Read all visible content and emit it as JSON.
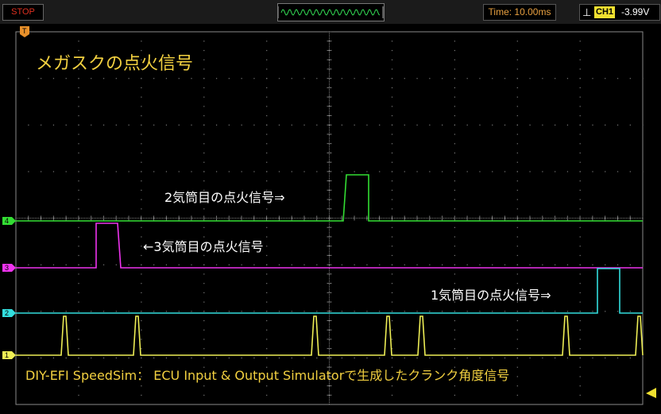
{
  "status": {
    "run_state": "STOP"
  },
  "timebase": {
    "label": "Time: 10.00ms"
  },
  "trigger": {
    "channel": "CH1",
    "level": "-3.99V"
  },
  "trigger_marker": {
    "label": "T"
  },
  "channels": [
    {
      "id": "4",
      "color": "#33dd33"
    },
    {
      "id": "3",
      "color": "#ee33ee"
    },
    {
      "id": "2",
      "color": "#33dddd"
    },
    {
      "id": "1",
      "color": "#eeee55"
    }
  ],
  "screen": {
    "title": "メガスクの点火信号",
    "annotation_cyl2": "2気筒目の点火信号⇒",
    "annotation_cyl3": "←3気筒目の点火信号",
    "annotation_cyl1": "1気筒目の点火信号⇒",
    "footer": "DIY-EFI SpeedSim： ECU Input & Output Simulatorで生成したクランク角度信号"
  },
  "colors": {
    "grid": "#7a7a7a",
    "title_text": "#f2d040",
    "stop_text": "#e03020",
    "time_text": "#e8a040"
  }
}
